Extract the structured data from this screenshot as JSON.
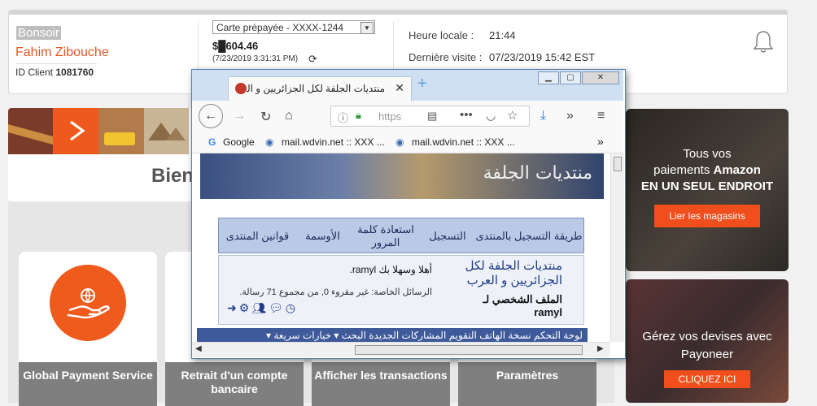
{
  "account": {
    "greeting": "Bonsoir",
    "name": "Fahim Zibouche",
    "client_label": "ID Client",
    "client_id": "1081760",
    "card_select": "Carte prépayée - XXXX-1244",
    "balance": "$█604.46",
    "balance_time": "(7/23/2019 3:31:31 PM)",
    "local_time_label": "Heure locale :",
    "local_time": "21:44",
    "last_visit_label": "Dernière visite :",
    "last_visit": "07/23/2019 15:42 EST"
  },
  "banner": {
    "welcome_partial": "Bien"
  },
  "services": [
    {
      "label": "Global Payment Service"
    },
    {
      "label": "Retrait d'un compte bancaire"
    },
    {
      "label": "Afficher les transactions"
    },
    {
      "label": "Paramètres"
    }
  ],
  "ads": {
    "amazon": {
      "line1": "Tous vos",
      "line2a": "paiements",
      "line2b": "Amazon",
      "line3": "EN UN SEUL ENDROIT",
      "button": "Lier les magasins"
    },
    "payoneer": {
      "line1": "Gérez vos devises avec",
      "line2": "Payoneer",
      "button": "CLIQUEZ ICI"
    }
  },
  "browser": {
    "tab_title": "منتديات الجلفة لكل الجزائريين و العرب",
    "url_text": "https",
    "bookmarks": [
      "Google",
      "mail.wdvin.net :: XXX ...",
      "mail.wdvin.net :: XXX ..."
    ],
    "forum": {
      "logo": "منتديات الجلفة",
      "nav": [
        "طريقة التسجيل بالمنتدى",
        "التسجيل",
        "استعادة كلمة المرور",
        "الأوسمة",
        "قوانين المنتدى"
      ],
      "forum_name": "منتديات الجلفة لكل الجزائريين و العرب",
      "profile_label": "الملف الشخصي لـ",
      "username": "ramyl",
      "welcome": "أهلا وسهلا بك ramyl.",
      "private_messages": "الرسائل الخاصة: غير مقروء 0, من مجموع 71 رسالة.",
      "bottom_nav": "لوحة التحكم  نسخة الهاتف  التقويم  المشاركات الجديدة  البحث ▾  خيارات سريعة ▾"
    }
  },
  "colors": {
    "accent": "#ef5a1d",
    "service_footer": "#7f7f7f"
  }
}
